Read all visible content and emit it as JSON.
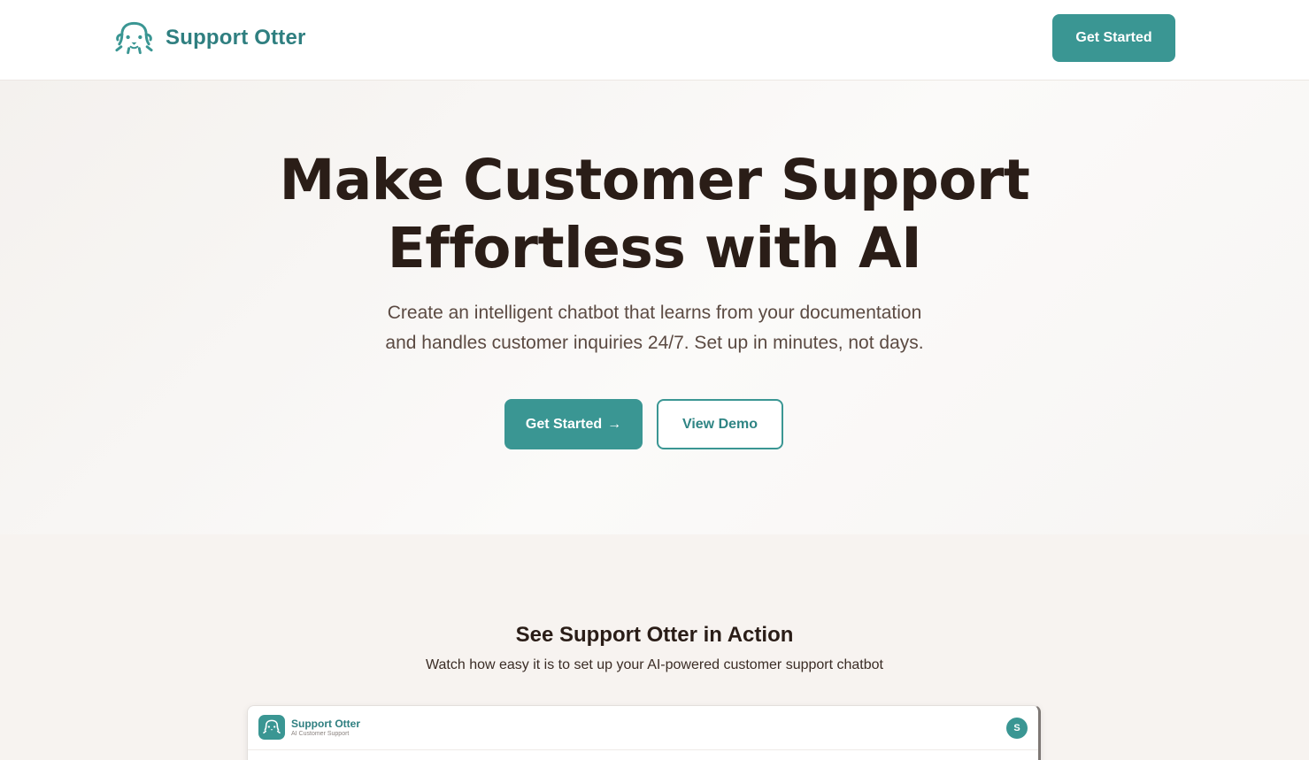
{
  "brand": {
    "name": "Support Otter",
    "logo_icon": "otter-icon"
  },
  "nav": {
    "cta_label": "Get Started"
  },
  "hero": {
    "title_line1": "Make Customer Support",
    "title_line2": "Effortless with AI",
    "subtitle_line1": "Create an intelligent chatbot that learns from your documentation",
    "subtitle_line2": "and handles customer inquiries 24/7. Set up in minutes, not days.",
    "primary_label": "Get Started",
    "primary_arrow": "→",
    "secondary_label": "View Demo"
  },
  "demo": {
    "title": "See Support Otter in Action",
    "subtitle": "Watch how easy it is to set up your AI-powered customer support chatbot",
    "preview": {
      "app_name": "Support Otter",
      "tagline": "AI Customer Support",
      "avatar_initial": "S"
    }
  },
  "colors": {
    "accent": "#3a9693",
    "brand_text": "#2f7f80",
    "heading": "#2a1d17",
    "page_bg": "#f7f3f0"
  }
}
